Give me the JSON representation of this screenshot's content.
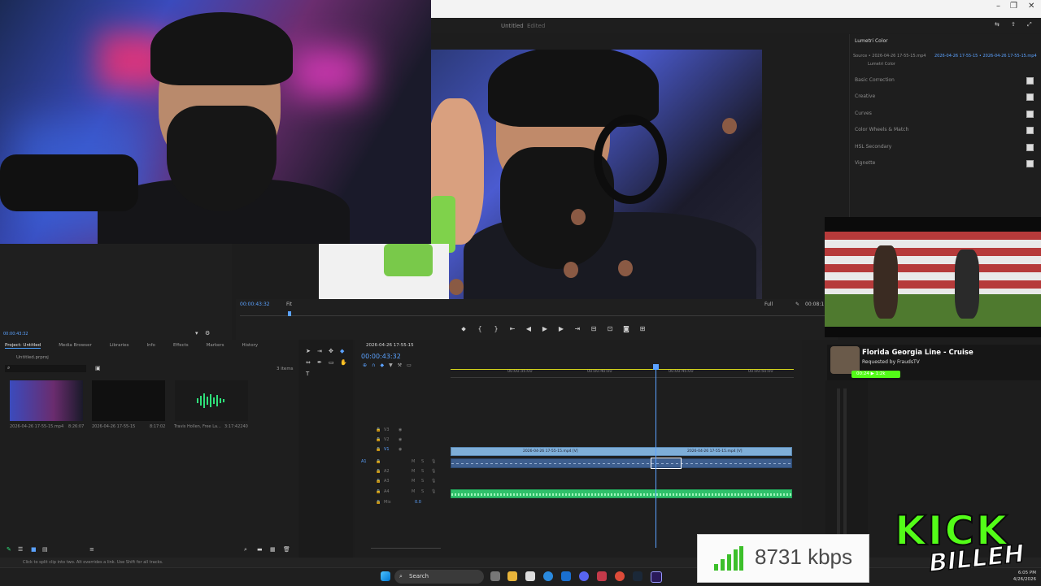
{
  "window": {
    "title": "Untitled",
    "edited": "Edited"
  },
  "program": {
    "timecode": "00:00:43:32",
    "fit": "Fit",
    "full": "Full",
    "end_timecode": "00:08:1"
  },
  "source": {
    "timecode": "00:00:43:32"
  },
  "lumetri": {
    "panel_title": "Lumetri Color",
    "source_line": "Source • 2026-04-26 17-55-15.mp4",
    "target_line": "2026-04-26 17-55-15 • 2026-04-26 17-55-15.mp4",
    "sub_title": "Lumetri Color",
    "sections": [
      "Basic Correction",
      "Creative",
      "Curves",
      "Color Wheels & Match",
      "HSL Secondary",
      "Vignette"
    ]
  },
  "project": {
    "tabs": [
      "Project: Untitled",
      "Media Browser",
      "Libraries",
      "Info",
      "Effects",
      "Markers",
      "History"
    ],
    "file": "Untitled.prproj",
    "count": "3 items",
    "items": [
      {
        "name": "2026-04-26 17-55-15.mp4",
        "duration": "8:26:07"
      },
      {
        "name": "2026-04-26 17-55-15",
        "duration": "8:17:02"
      },
      {
        "name": "Travis Hollen, Free La...",
        "duration": "3:17:42240"
      }
    ]
  },
  "timeline": {
    "sequence": "2026-04-26 17-55-15",
    "timecode": "00:00:43:32",
    "ruler": [
      "00:00:35:00",
      "00:00:40:00",
      "00:00:45:00",
      "00:00:50:00"
    ],
    "video_tracks": [
      "V3",
      "V2",
      "V1"
    ],
    "audio_tracks": [
      "A1",
      "A2",
      "A3",
      "A4"
    ],
    "mix_label": "Mix",
    "mix_value": "0.0",
    "clip_label": "2026-04-26 17-55-15.mp4 [V]"
  },
  "status_text": "Click to split clip into two. Alt overrides a link. Use Shift for all tracks.",
  "now_playing": {
    "title": "Florida Georgia Line - Cruise",
    "requested": "Requested by FraudsTV",
    "tag": "00:24 ▶ 1:2k"
  },
  "stream": {
    "bitrate": "8731 kbps"
  },
  "branding": {
    "kick": "KICK",
    "channel": "BILLEH"
  },
  "taskbar": {
    "search": "Search",
    "time": "6:05 PM",
    "date": "4/26/2026"
  },
  "colors": {
    "accent": "#5ba2ff",
    "kick_green": "#53fc18",
    "clip_video": "#7eaed8",
    "clip_audio": "#2fc06a"
  }
}
